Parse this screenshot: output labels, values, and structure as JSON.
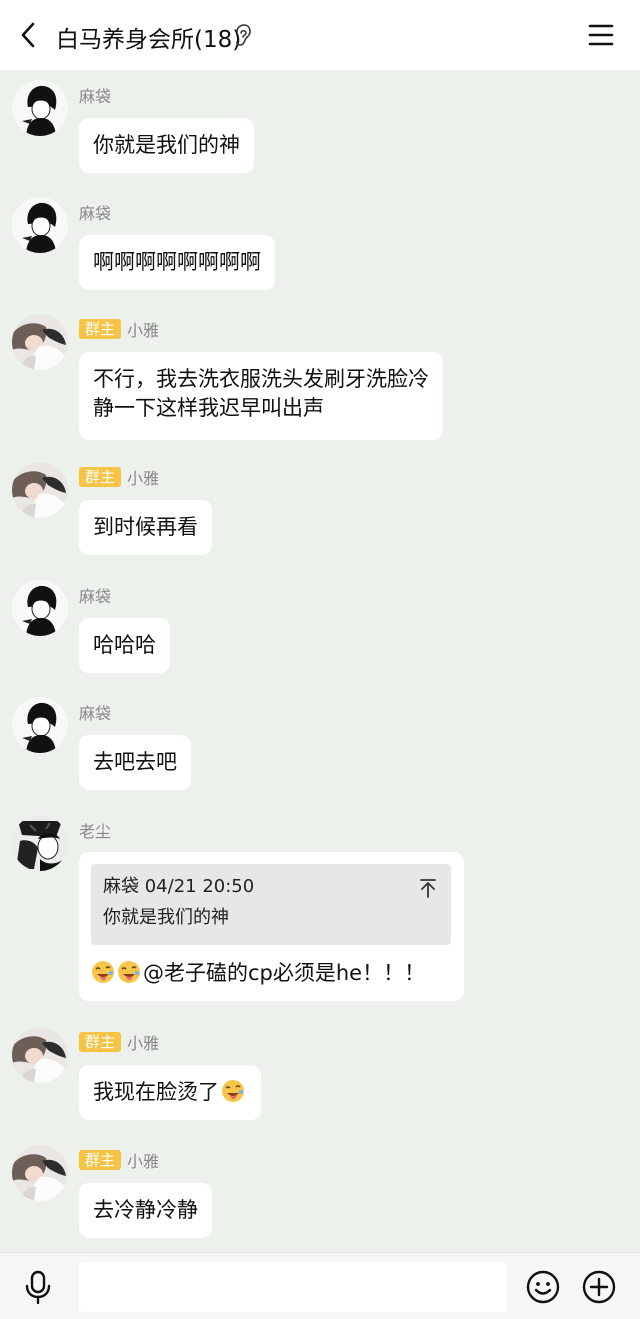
{
  "header": {
    "title": "白马养身会所(18)"
  },
  "messages": [
    {
      "sender": "麻袋",
      "text": "你就是我们的神"
    },
    {
      "sender": "麻袋",
      "text": "啊啊啊啊啊啊啊啊"
    },
    {
      "badge": "群主",
      "sender": "小雅",
      "lines": [
        "不行，我去洗衣服洗头发刷牙洗脸冷",
        "静一下这样我迟早叫出声"
      ]
    },
    {
      "badge": "群主",
      "sender": "小雅",
      "text": "到时候再看"
    },
    {
      "sender": "麻袋",
      "text": "哈哈哈"
    },
    {
      "sender": "麻袋",
      "text": "去吧去吧"
    },
    {
      "sender": "老尘",
      "quote": {
        "meta": "麻袋 04/21 20:50",
        "text": "你就是我们的神"
      },
      "text": "@老子磕的cp必须是he！！！"
    },
    {
      "badge": "群主",
      "sender": "小雅",
      "text": "我现在脸烫了"
    },
    {
      "badge": "群主",
      "sender": "小雅",
      "text": "去冷静冷静"
    }
  ],
  "input": {
    "value": ""
  }
}
